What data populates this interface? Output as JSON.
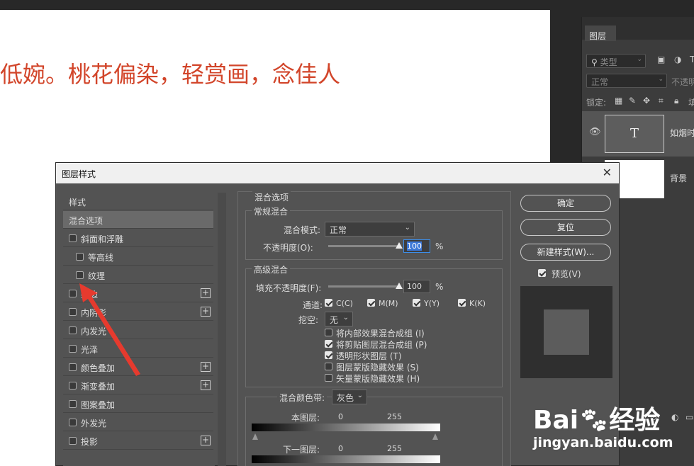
{
  "document": {
    "text": "低婉。桃花偏染，轻赏画，念佳人"
  },
  "layers_panel": {
    "tab": "图层",
    "filter_placeholder": "类型",
    "blend_mode": "正常",
    "opacity_label": "不透明",
    "lock_label": "锁定:",
    "fill_label": "填",
    "layers": [
      {
        "name": "如烟时",
        "type": "text",
        "thumb_glyph": "T",
        "selected": true,
        "visible": true
      },
      {
        "name": "背景",
        "type": "image",
        "selected": false,
        "visible": false
      }
    ]
  },
  "dialog": {
    "title": "图层样式",
    "styles": [
      {
        "label": "样式",
        "checkbox": false,
        "plus": false,
        "indent": 0,
        "header": true
      },
      {
        "label": "混合选项",
        "checkbox": false,
        "plus": false,
        "indent": 0,
        "selected": true
      },
      {
        "label": "斜面和浮雕",
        "checkbox": true,
        "checked": false,
        "plus": false,
        "indent": 0
      },
      {
        "label": "等高线",
        "checkbox": true,
        "checked": false,
        "plus": false,
        "indent": 1
      },
      {
        "label": "纹理",
        "checkbox": true,
        "checked": false,
        "plus": false,
        "indent": 1
      },
      {
        "label": "描边",
        "checkbox": true,
        "checked": false,
        "plus": true,
        "indent": 0
      },
      {
        "label": "内阴影",
        "checkbox": true,
        "checked": false,
        "plus": true,
        "indent": 0
      },
      {
        "label": "内发光",
        "checkbox": true,
        "checked": false,
        "plus": false,
        "indent": 0
      },
      {
        "label": "光泽",
        "checkbox": true,
        "checked": false,
        "plus": false,
        "indent": 0
      },
      {
        "label": "颜色叠加",
        "checkbox": true,
        "checked": false,
        "plus": true,
        "indent": 0
      },
      {
        "label": "渐变叠加",
        "checkbox": true,
        "checked": false,
        "plus": true,
        "indent": 0
      },
      {
        "label": "图案叠加",
        "checkbox": true,
        "checked": false,
        "plus": false,
        "indent": 0
      },
      {
        "label": "外发光",
        "checkbox": true,
        "checked": false,
        "plus": false,
        "indent": 0
      },
      {
        "label": "投影",
        "checkbox": true,
        "checked": false,
        "plus": true,
        "indent": 0
      }
    ],
    "blend_options": {
      "title": "混合选项",
      "general": {
        "title": "常规混合",
        "mode_label": "混合模式:",
        "mode": "正常",
        "opacity_label": "不透明度(O):",
        "opacity": "100",
        "opacity_fraction": 1.0,
        "unit": "%"
      },
      "advanced": {
        "title": "高级混合",
        "fill_label": "填充不透明度(F):",
        "fill": "100",
        "fill_fraction": 1.0,
        "unit": "%",
        "channels_label": "通道:",
        "channels": [
          "C(C)",
          "M(M)",
          "Y(Y)",
          "K(K)"
        ],
        "knockout_label": "挖空:",
        "knockout": "无",
        "options": [
          {
            "label": "将内部效果混合成组 (I)",
            "checked": false
          },
          {
            "label": "将剪贴图层混合成组 (P)",
            "checked": true
          },
          {
            "label": "透明形状图层 (T)",
            "checked": true
          },
          {
            "label": "图层蒙版隐藏效果 (S)",
            "checked": false
          },
          {
            "label": "矢量蒙版隐藏效果 (H)",
            "checked": false
          }
        ]
      },
      "blend_if": {
        "label": "混合颜色带:",
        "value": "灰色",
        "this_layer_label": "本图层:",
        "underlying_label": "下一图层:",
        "min": "0",
        "max": "255"
      }
    },
    "buttons": {
      "ok": "确定",
      "reset": "复位",
      "new_style": "新建样式(W)...",
      "preview": "预览(V)"
    }
  },
  "watermark": {
    "brand_left": "Bai",
    "brand_right": "经验",
    "url": "jingyan.baidu.com"
  }
}
